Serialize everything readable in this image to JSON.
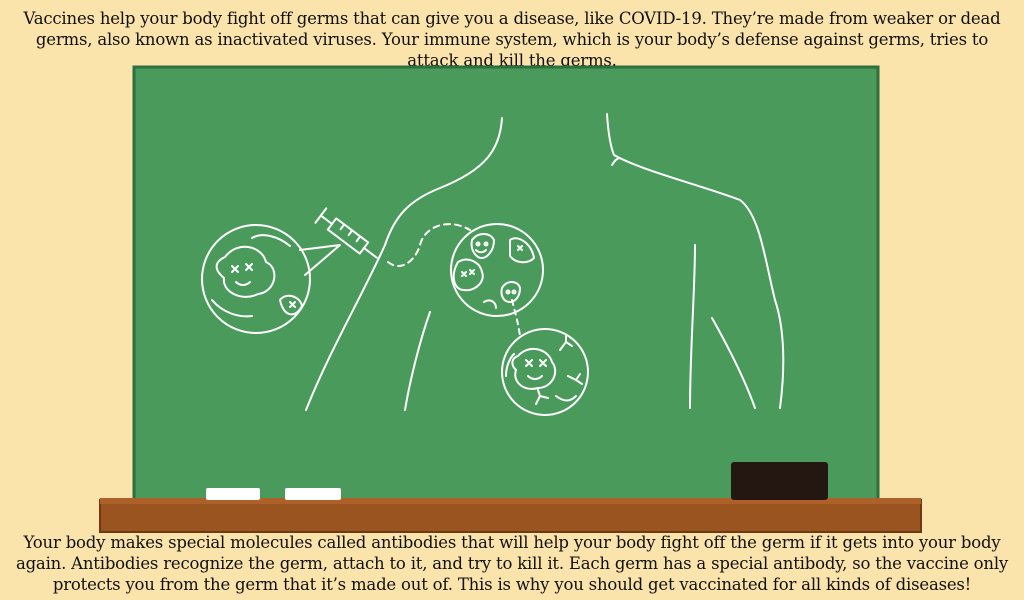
{
  "intro_text": "Vaccines help your body fight off germs that can give you a disease, like COVID-19. They’re made from weaker or dead germs, also known as inactivated viruses. Your immune system, which is your body’s defense against germs, tries to attack and kill the germs.",
  "outro_text": "Your body makes special molecules called antibodies that will help your body fight off the germ if it gets into your body again. Antibodies recognize the germ, attach to it, and try to kill it. Each germ has a special antibody, so the vaccine only protects you from the germ that it’s made out of. This is why you should get vaccinated for all kinds of diseases!",
  "colors": {
    "background": "#fbe3ac",
    "chalkboard": "#4a9a5c",
    "chalkboard_frame": "#2f6e3e",
    "chalk": "#ffffff",
    "ledge": "#9a5420",
    "eraser": "#241610"
  }
}
